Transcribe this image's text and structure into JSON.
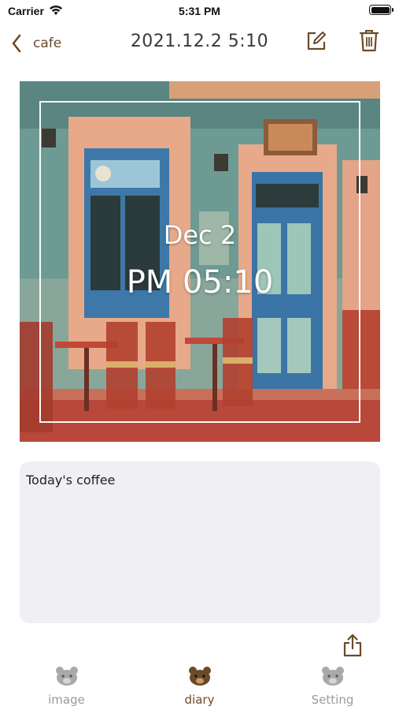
{
  "status_bar": {
    "carrier": "Carrier",
    "time": "5:31 PM"
  },
  "nav": {
    "back_label": "cafe",
    "title": "2021.12.2 5:10",
    "edit_icon": "edit-icon",
    "delete_icon": "trash-icon"
  },
  "photo": {
    "date": "Dec 2",
    "time": "PM 05:10"
  },
  "note": {
    "text": "Today's coffee"
  },
  "share_icon": "share-icon",
  "tabs": [
    {
      "label": "image",
      "icon": "bear-icon",
      "active": false
    },
    {
      "label": "diary",
      "icon": "bear-icon",
      "active": true
    },
    {
      "label": "Setting",
      "icon": "bear-icon",
      "active": false
    }
  ],
  "colors": {
    "accent": "#6b4a2a",
    "inactive": "#9a9a9a",
    "note_bg": "#efeff4"
  }
}
